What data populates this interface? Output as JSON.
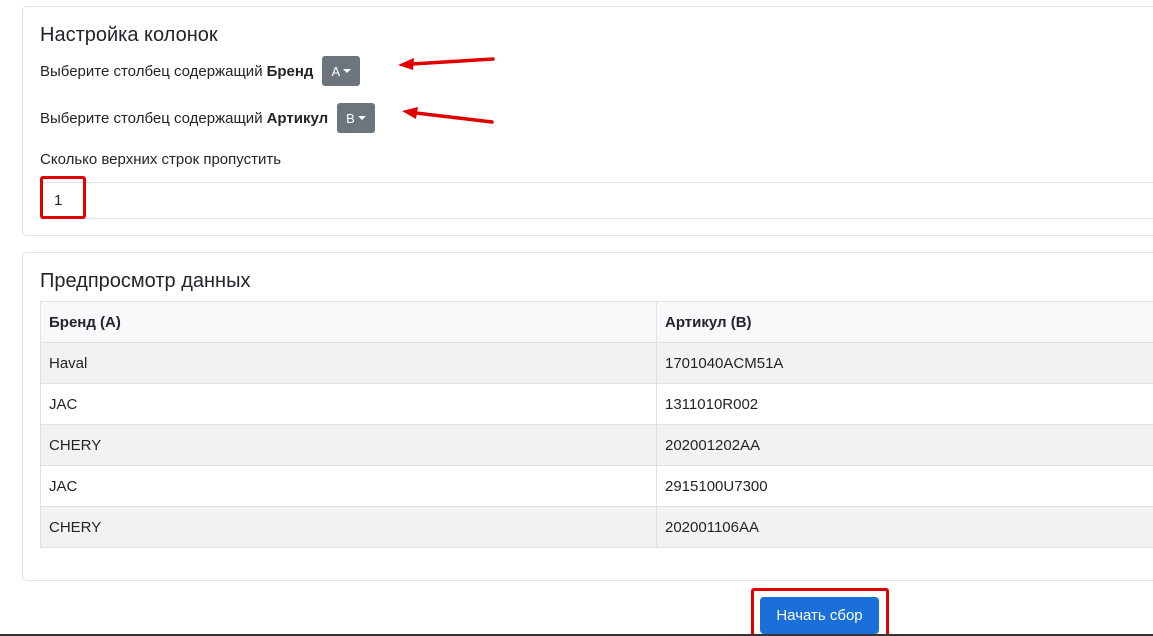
{
  "settings": {
    "title": "Настройка колонок",
    "brand_prefix": "Выберите столбец содержащий",
    "brand_bold": "Бренд",
    "brand_value": "A",
    "article_prefix": "Выберите столбец содержащий",
    "article_bold": "Артикул",
    "article_value": "B",
    "skip_label": "Сколько верхних строк пропустить",
    "skip_value": "1"
  },
  "preview": {
    "title": "Предпросмотр данных",
    "columns": [
      "Бренд (A)",
      "Артикул (B)"
    ],
    "rows": [
      [
        "Haval",
        "1701040ACM51A"
      ],
      [
        "JAC",
        "1311010R002"
      ],
      [
        "CHERY",
        "202001202AA"
      ],
      [
        "JAC",
        "2915100U7300"
      ],
      [
        "CHERY",
        "202001106AA"
      ]
    ]
  },
  "actions": {
    "start_label": "Начать сбор"
  },
  "annotations": {
    "arrow_color": "#e10000",
    "button_color": "#1a6fd8",
    "dropdown_color": "#6c757d"
  }
}
